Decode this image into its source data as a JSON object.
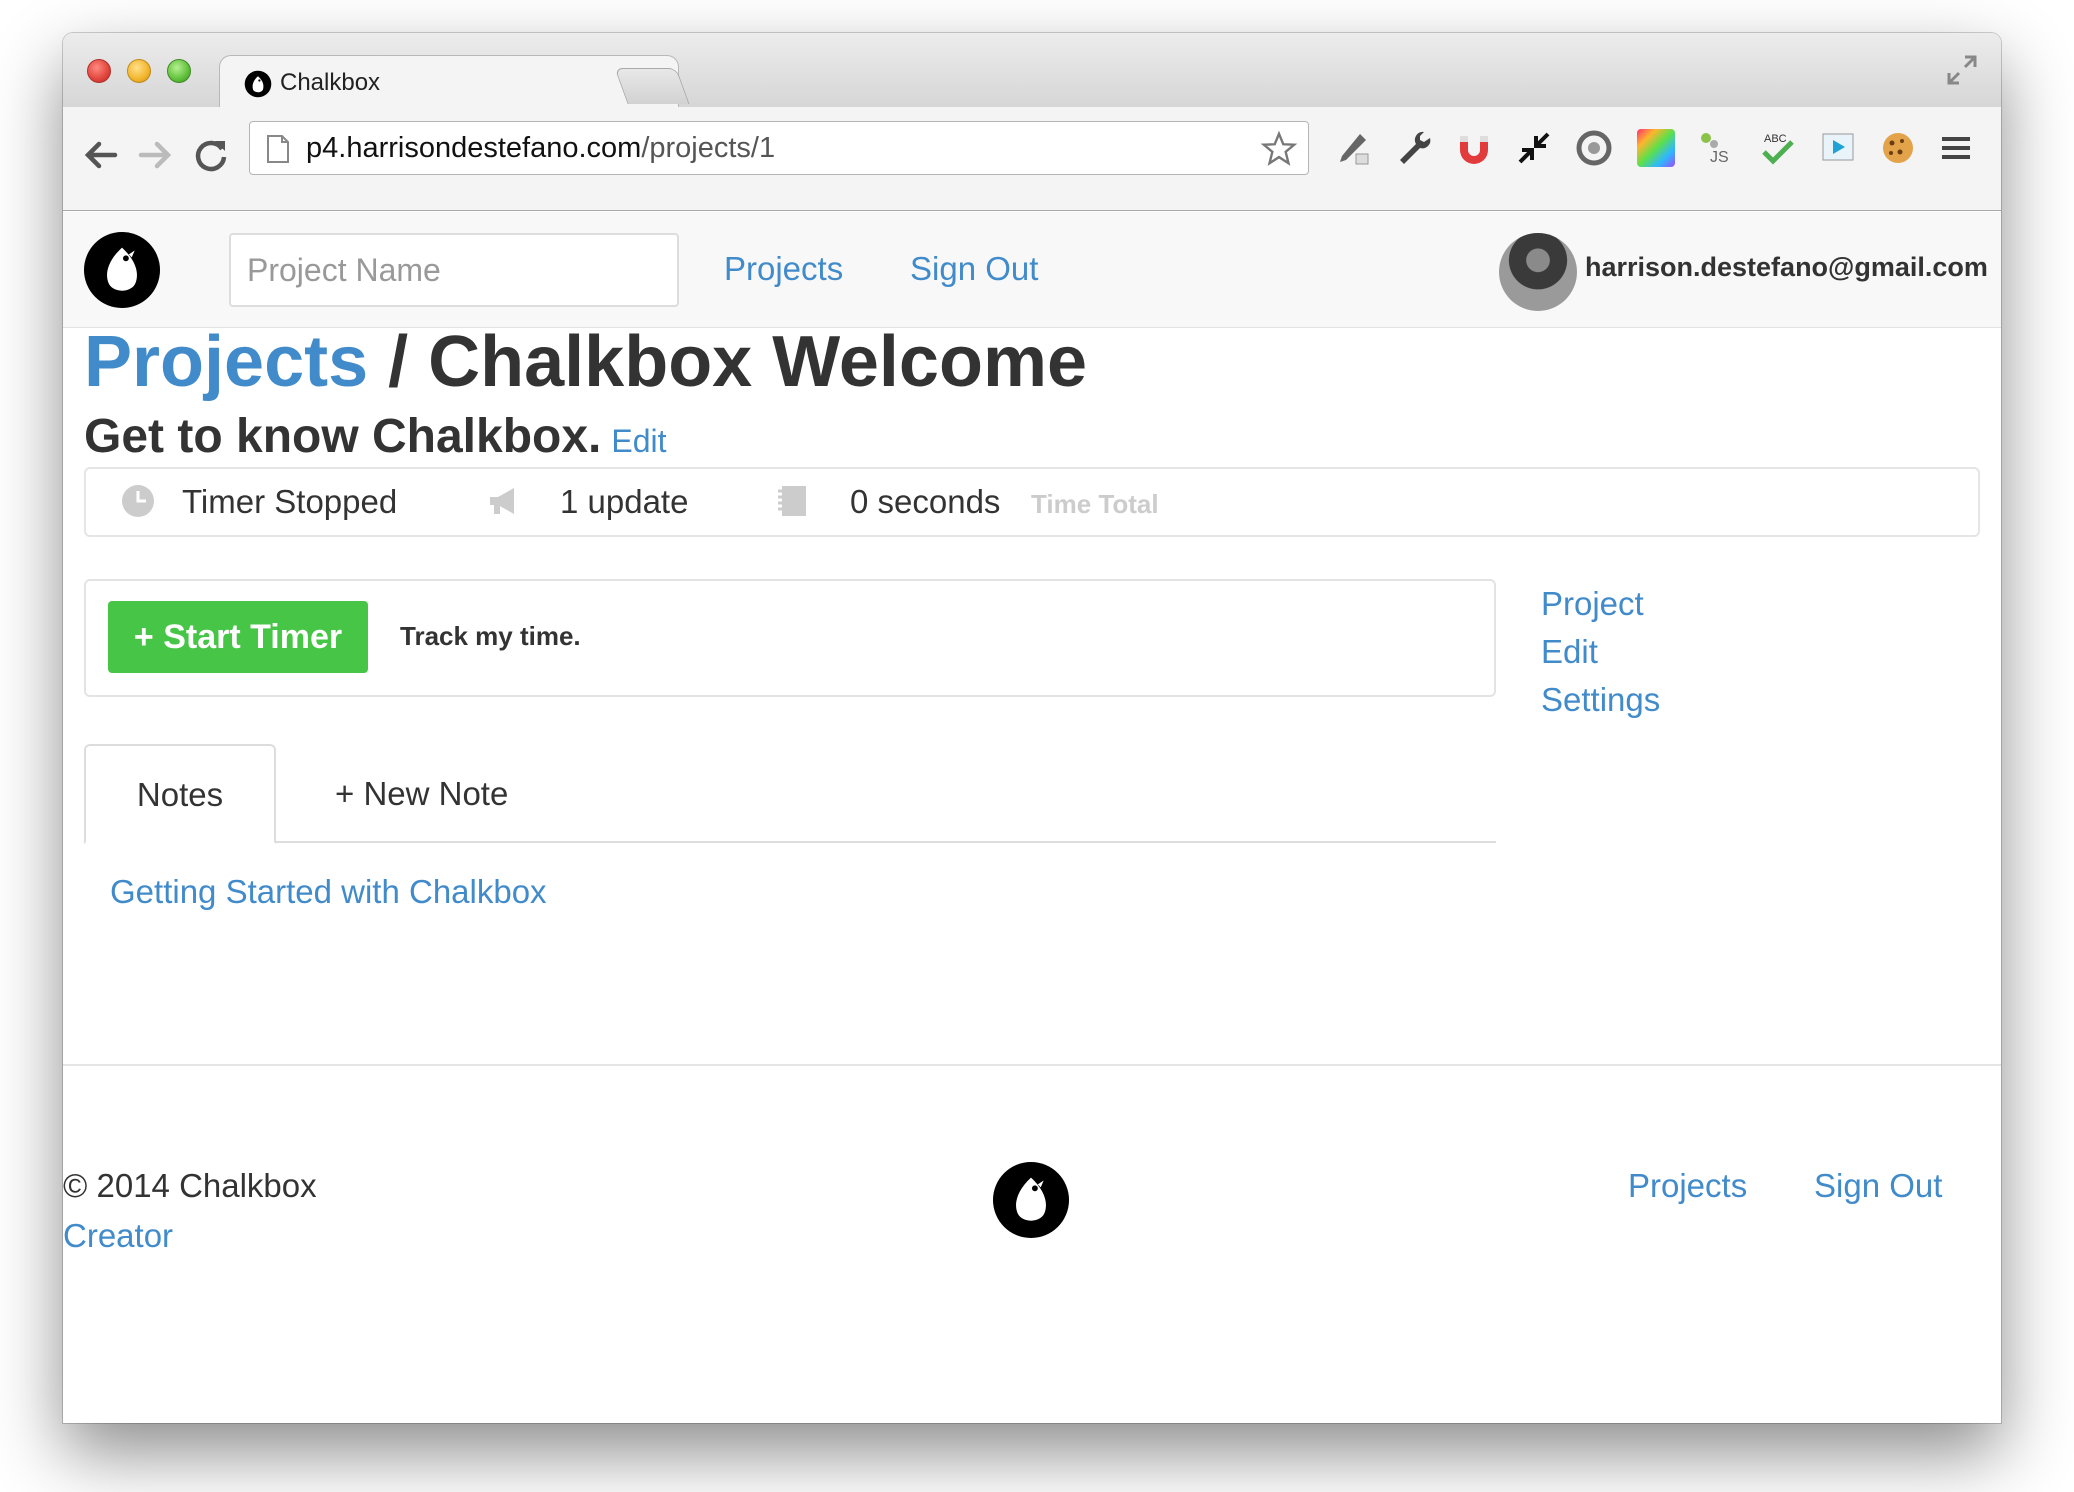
{
  "browser": {
    "tab_title": "Chalkbox",
    "tab_close": "×",
    "url_host": "p4.harrisondestefano.com",
    "url_path": "/projects/1"
  },
  "navbar": {
    "search_placeholder": "Project Name",
    "links": [
      "Projects",
      "Sign Out"
    ],
    "user_email": "harrison.destefano@gmail.com"
  },
  "page": {
    "breadcrumb_link": "Projects",
    "title_rest": " / Chalkbox Welcome",
    "subtitle": "Get to know Chalkbox.",
    "subtitle_edit": "Edit"
  },
  "stats": {
    "timer_status": "Timer Stopped",
    "updates": "1 update",
    "time": "0 seconds",
    "time_label": "Time Total"
  },
  "timer": {
    "button_label": "+ Start Timer",
    "description": "Track my time."
  },
  "sidebar": {
    "links": [
      "Project",
      "Edit",
      "Settings"
    ]
  },
  "notes": {
    "tabs": [
      "Notes",
      "+ New Note"
    ],
    "items": [
      "Getting Started with Chalkbox"
    ]
  },
  "footer": {
    "copyright": "© 2014 Chalkbox",
    "creator_link": "Creator",
    "links": [
      "Projects",
      "Sign Out"
    ]
  },
  "colors": {
    "link": "#428bca",
    "start_button": "#46c547",
    "text": "#333333"
  }
}
